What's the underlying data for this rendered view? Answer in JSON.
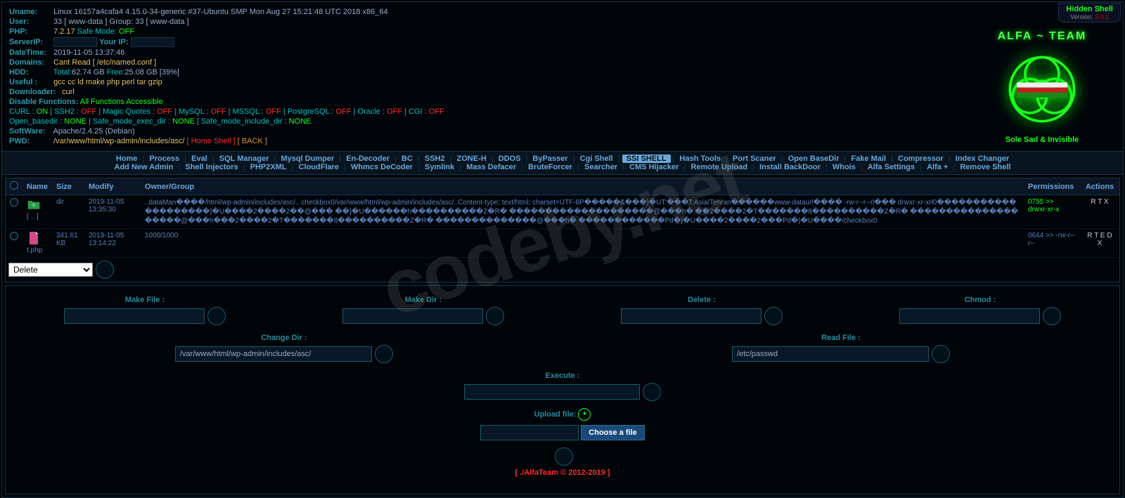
{
  "topbar": {
    "title": "Hidden Shell",
    "verlabel": "Version: ",
    "version": "3.0.1"
  },
  "info": {
    "uname_lab": "Uname:",
    "uname": "Linux 16157a4cafa4 4.15.0-34-generic #37-Ubuntu SMP Mon Aug 27 15:21:48 UTC 2018 x86_64",
    "user_lab": "User:",
    "user": "33 [ www-data ] Group: 33 [ www-data ]",
    "php_lab": "PHP:",
    "php_ver": "7.2.17",
    "safe_lab": "Safe Mode:",
    "safe_val": "OFF",
    "serverip_lab": "ServerIP:",
    "yourip_lab": "Your IP:",
    "datetime_lab": "DateTime:",
    "datetime": "2019-11-05 13:37:46",
    "domains_lab": "Domains:",
    "domains": "Cant Read [ /etc/named.conf ]",
    "hdd_lab": "HDD:",
    "hdd_total_lab": "Total:",
    "hdd_total": "62.74 GB",
    "hdd_free_lab": "Free:",
    "hdd_free": "25.08 GB [39%]",
    "useful_lab": "Useful :",
    "useful": "gcc cc ld make php perl tar gzip",
    "down_lab": "Downloader:",
    "down": "curl",
    "disable_lab": "Disable Functions:",
    "disable_val": "All Functions Accessible",
    "curl_lab": "CURL :",
    "on": "ON",
    "off": "OFF",
    "ssh2_lab": "SSH2 :",
    "mq_lab": "Magic Quotes :",
    "mysql_lab": "MySQL :",
    "mssql_lab": "MSSQL :",
    "pg_lab": "PostgreSQL :",
    "oracle_lab": "Oracle :",
    "cgi_lab": "CGI :",
    "ob_lab": "Open_basedir :",
    "none": "NONE",
    "smed_lab": "Safe_mode_exec_dir :",
    "smid_lab": "Safe_mode_include_dir :",
    "sw_lab": "SoftWare:",
    "sw": "Apache/2.4.25 (Debian)",
    "pwd_lab": "PWD:",
    "pwd_path": "/var/www/html/wp-admin/includes/asc/",
    "home_shell": "[ Home Shell ]",
    "back": "[ BACK ]",
    "tagline": "Sole Sad & Invisible",
    "brand": "ALFA ~ TEAM"
  },
  "menu": {
    "row1": [
      "Home",
      "Process",
      "Eval",
      "SQL Manager",
      "Mysql Dumper",
      "En-Decoder",
      "BC",
      "SSH2",
      "ZONE-H",
      "DDOS",
      "ByPasser",
      "Cgi Shell",
      "SSI SHELL",
      "Hash Tools",
      "Port Scaner",
      "Open BaseDir",
      "Fake Mail",
      "Compressor",
      "Index Changer"
    ],
    "row2": [
      "Add New Admin",
      "Shell Injectors",
      "PHP2XML",
      "CloudFlare",
      "Whmcs DeCoder",
      "Symlink",
      "Mass Defacer",
      "BruteForcer",
      "Searcher",
      "CMS Hijacker",
      "Remote Upload",
      "Install BackDoor",
      "Whois",
      "Alfa Settings",
      "Alfa +",
      "Remove Shell"
    ],
    "active": "SSI SHELL"
  },
  "table": {
    "headers": {
      "name": "Name",
      "size": "Size",
      "modify": "Modify",
      "owner": "Owner/Group",
      "perms": "Permissions",
      "actions": "Actions"
    },
    "rows": [
      {
        "name": "[ .. ]",
        "size": "dir",
        "modify": "2019-11-05 13:35:30",
        "owner": "..dataMan����/html/wp-admin/includes/asc/.. checkbox0/var/www/html/wp-admin/includes/asc/..Content-type: text/html; charset=UTF-8P�����&���}�UT'���T:Asia/Tehran������www-dataurl���� -rw-r--r--rl��� drwxr-xr-xrl0��������������������}�U����2����2��@��� ��}�U������h����������Z�R� ��������������������@���h� ��2����2�T�������8����������Z�R� ��������������������@���h���2����2�T�������8����������Z�R� ��������������@���h� ������������Pd�}�U����2����2���Pd�}�U����/checkbox0",
        "perm": "0755 >>",
        "perm2": "drwxr-xr-x",
        "actions": "R T X"
      },
      {
        "name": "t.php",
        "size": "341.61 KB",
        "modify": "2019-11-05 13:14:22",
        "owner": "1000/1000",
        "perm": "0644 >> -rw-r--r--",
        "actions": "R T E D X"
      }
    ],
    "delete": "Delete"
  },
  "tools": {
    "makefile": "Make File :",
    "makedir": "Make Dir :",
    "delete": "Delete :",
    "chmod": "Chmod :",
    "changedir": "Change Dir :",
    "changedir_val": "/var/www/html/wp-admin/includes/asc/",
    "readfile": "Read File :",
    "readfile_val": "/etc/passwd",
    "execute": "Execute :",
    "upload": "Upload file:",
    "choose": "Choose a file"
  },
  "footer": "[ ./AlfaTeam © 2012-2019 ]",
  "watermark": "codeby.net"
}
